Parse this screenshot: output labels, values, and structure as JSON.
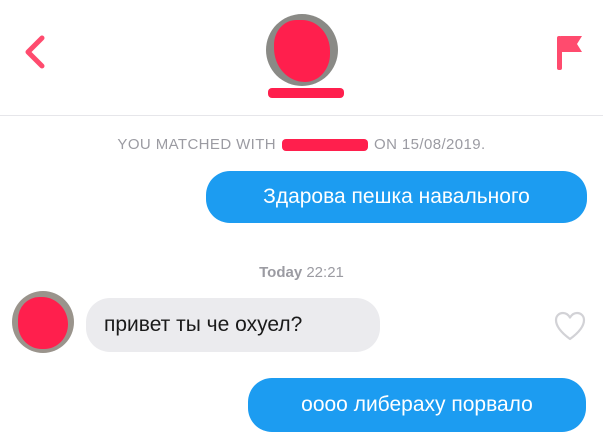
{
  "header": {
    "back_icon": "chevron-left-icon",
    "report_icon": "flag-icon",
    "accent_color": "#ff4b6e"
  },
  "match_info": {
    "prefix": "YOU MATCHED WITH",
    "suffix": "ON 15/08/2019."
  },
  "messages": [
    {
      "direction": "outgoing",
      "text": "Здарова пешка навального"
    },
    {
      "direction": "incoming",
      "text": "привет ты че охуел?"
    },
    {
      "direction": "outgoing",
      "text": "оооо либераху порвало"
    }
  ],
  "timestamp": {
    "day": "Today",
    "time": "22:21"
  },
  "colors": {
    "outgoing_bubble": "#1c9cf1",
    "incoming_bubble": "#ebebee",
    "redaction": "#ff1f4d"
  },
  "like_icon": "heart-outline-icon"
}
